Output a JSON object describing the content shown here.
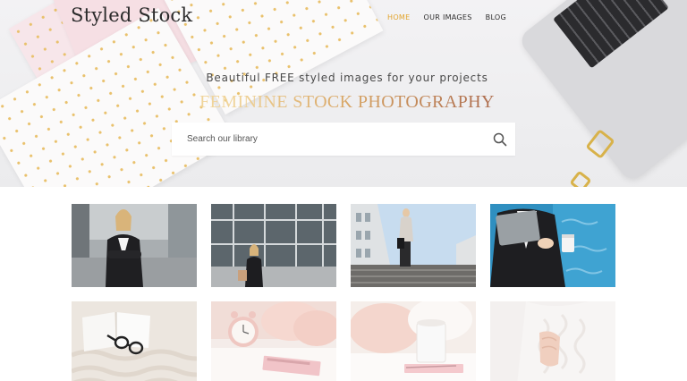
{
  "brand": {
    "logo_text": "Styled Stock",
    "accent_color": "#e2a52d"
  },
  "nav": {
    "items": [
      {
        "label": "HOME",
        "active": true
      },
      {
        "label": "OUR IMAGES",
        "active": false
      },
      {
        "label": "BLOG",
        "active": false
      }
    ]
  },
  "hero": {
    "tagline": "Beautiful FREE styled images for your projects",
    "headline": "FEMININE STOCK PHOTOGRAPHY"
  },
  "search": {
    "placeholder": "Search our library",
    "value": "",
    "icon": "search-icon"
  },
  "gallery": {
    "images": [
      {
        "subject": "businesswoman-crossed-arms"
      },
      {
        "subject": "businesswoman-glass-building"
      },
      {
        "subject": "woman-on-stairs"
      },
      {
        "subject": "woman-with-tablet-and-coffee"
      },
      {
        "subject": "open-book-with-glasses"
      },
      {
        "subject": "pink-alarm-clock"
      },
      {
        "subject": "mug-with-pillows"
      },
      {
        "subject": "white-sweater"
      }
    ]
  }
}
